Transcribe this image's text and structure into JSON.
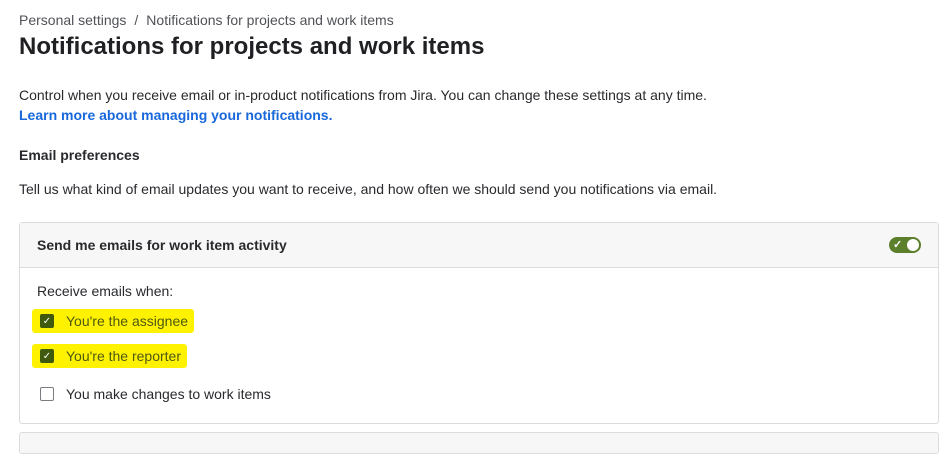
{
  "breadcrumb": [
    "Personal settings",
    "Notifications for projects and work items"
  ],
  "title": "Notifications for projects and work items",
  "description": "Control when you receive email or in-product notifications from Jira. You can change these settings at any time.",
  "learn_more": "Learn more about managing your notifications.",
  "email": {
    "heading": "Email preferences",
    "description": "Tell us what kind of email updates you want to receive, and how often we should send you notifications via email.",
    "card_title": "Send me emails for work item activity",
    "toggle_on": true,
    "receive_label": "Receive emails when:",
    "options": [
      {
        "label": "You're the assignee",
        "checked": true
      },
      {
        "label": "You're the reporter",
        "checked": true
      },
      {
        "label": "You make changes to work items",
        "checked": false
      }
    ]
  }
}
